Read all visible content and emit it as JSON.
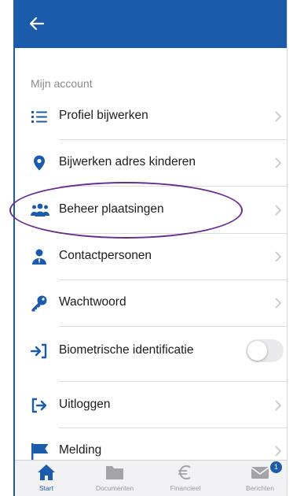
{
  "header": {
    "back_icon": "arrow-left-icon"
  },
  "section_title": "Mijn account",
  "colors": {
    "brand": "#1a5bab",
    "highlight": "#6b2a8f"
  },
  "menu": [
    {
      "label": "Profiel bijwerken",
      "icon": "list-icon"
    },
    {
      "label": "Bijwerken adres kinderen",
      "icon": "map-pin-icon"
    },
    {
      "label": "Beheer plaatsingen",
      "icon": "users-icon"
    },
    {
      "label": "Contactpersonen",
      "icon": "contact-person-icon"
    },
    {
      "label": "Wachtwoord",
      "icon": "key-icon"
    },
    {
      "label": "Biometrische identificatie",
      "icon": "sign-in-icon",
      "toggle": false
    },
    {
      "label": "Uitloggen",
      "icon": "sign-out-icon"
    },
    {
      "label": "Melding",
      "icon": "flag-icon"
    }
  ],
  "tabbar": [
    {
      "label": "Start",
      "icon": "home-icon",
      "active": true
    },
    {
      "label": "Documenten",
      "icon": "folder-icon"
    },
    {
      "label": "Financieel",
      "icon": "euro-icon"
    },
    {
      "label": "Berichten",
      "icon": "envelope-icon",
      "badge": "1"
    }
  ]
}
